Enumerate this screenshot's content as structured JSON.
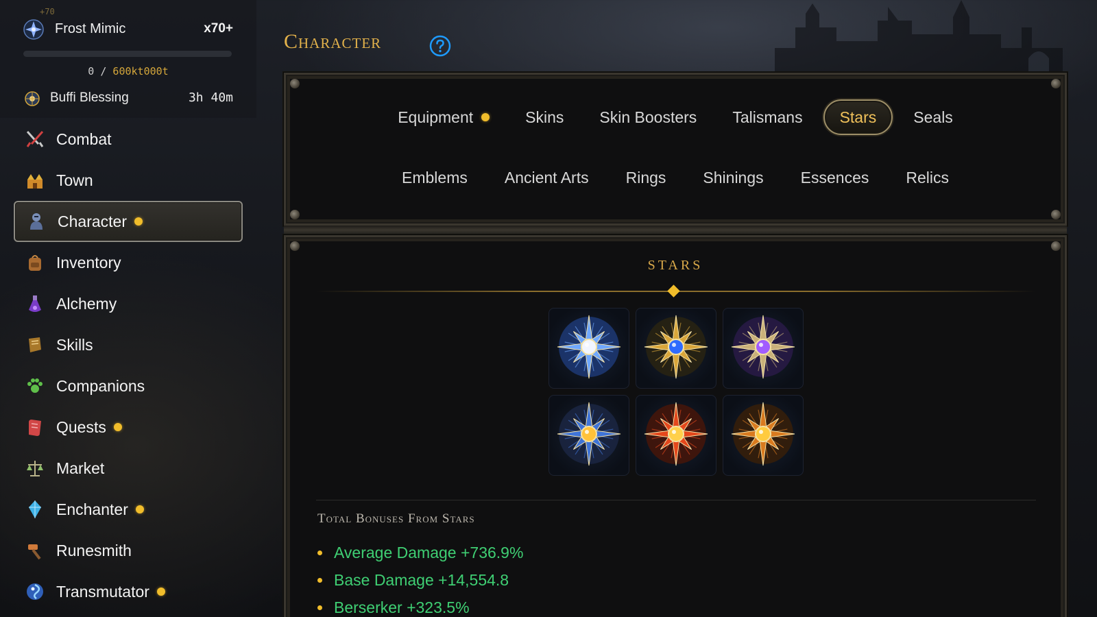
{
  "monster": {
    "level_tag": "+70",
    "name": "Frost Mimic",
    "multiplier": "x70+",
    "hp_current": "0",
    "hp_sep": "/",
    "hp_max": "600kt000t",
    "hp_fraction": 0
  },
  "buff": {
    "name": "Buffi Blessing",
    "time": "3h 40m"
  },
  "sidebar": {
    "items": [
      {
        "label": "Combat",
        "icon": "crossed-swords-icon",
        "dot": false,
        "active": false
      },
      {
        "label": "Town",
        "icon": "town-icon",
        "dot": false,
        "active": false
      },
      {
        "label": "Character",
        "icon": "knight-icon",
        "dot": true,
        "active": true
      },
      {
        "label": "Inventory",
        "icon": "backpack-icon",
        "dot": false,
        "active": false
      },
      {
        "label": "Alchemy",
        "icon": "potion-icon",
        "dot": false,
        "active": false
      },
      {
        "label": "Skills",
        "icon": "book-icon",
        "dot": false,
        "active": false
      },
      {
        "label": "Companions",
        "icon": "paw-icon",
        "dot": false,
        "active": false
      },
      {
        "label": "Quests",
        "icon": "scroll-icon",
        "dot": true,
        "active": false
      },
      {
        "label": "Market",
        "icon": "scales-icon",
        "dot": false,
        "active": false
      },
      {
        "label": "Enchanter",
        "icon": "crystal-icon",
        "dot": true,
        "active": false
      },
      {
        "label": "Runesmith",
        "icon": "hammer-icon",
        "dot": false,
        "active": false
      },
      {
        "label": "Transmutator",
        "icon": "swirl-orb-icon",
        "dot": true,
        "active": false
      }
    ]
  },
  "page": {
    "title": "Character",
    "help_icon": "question-circle-icon"
  },
  "tabs": {
    "row1": [
      {
        "label": "Equipment",
        "dot": true,
        "active": false
      },
      {
        "label": "Skins",
        "dot": false,
        "active": false
      },
      {
        "label": "Skin Boosters",
        "dot": false,
        "active": false
      },
      {
        "label": "Talismans",
        "dot": false,
        "active": false
      },
      {
        "label": "Stars",
        "dot": false,
        "active": true
      },
      {
        "label": "Seals",
        "dot": false,
        "active": false
      }
    ],
    "row2": [
      {
        "label": "Emblems"
      },
      {
        "label": "Ancient Arts"
      },
      {
        "label": "Rings"
      },
      {
        "label": "Shinings"
      },
      {
        "label": "Essences"
      },
      {
        "label": "Relics"
      }
    ]
  },
  "stars_section": {
    "title": "STARS",
    "stars": [
      {
        "name": "white-star-icon",
        "core": "#f2f6ff",
        "ray": "#6fa8ff",
        "glow": "#1e3b7a"
      },
      {
        "name": "blue-gold-star-icon",
        "core": "#2f6bff",
        "ray": "#d9a63a",
        "glow": "#2a2410"
      },
      {
        "name": "purple-star-icon",
        "core": "#a15cff",
        "ray": "#c9b07a",
        "glow": "#2b1a4a"
      },
      {
        "name": "gold-blue-star-icon",
        "core": "#ffc23a",
        "ray": "#3f74d8",
        "glow": "#1b2745"
      },
      {
        "name": "fire-star-icon",
        "core": "#ffd04a",
        "ray": "#e4471c",
        "glow": "#4a1508"
      },
      {
        "name": "amber-star-icon",
        "core": "#ffcb3f",
        "ray": "#d97a1f",
        "glow": "#3a1f08"
      }
    ],
    "bonus_title": "Total Bonuses From Stars",
    "bonuses": [
      "Average Damage +736.9%",
      "Base Damage +14,554.8",
      "Berserker +323.5%"
    ]
  },
  "colors": {
    "accent_gold": "#e3b24b",
    "notify_dot": "#f1bd2b",
    "bonus_green": "#3fcf73",
    "help_blue": "#1e9bff"
  }
}
